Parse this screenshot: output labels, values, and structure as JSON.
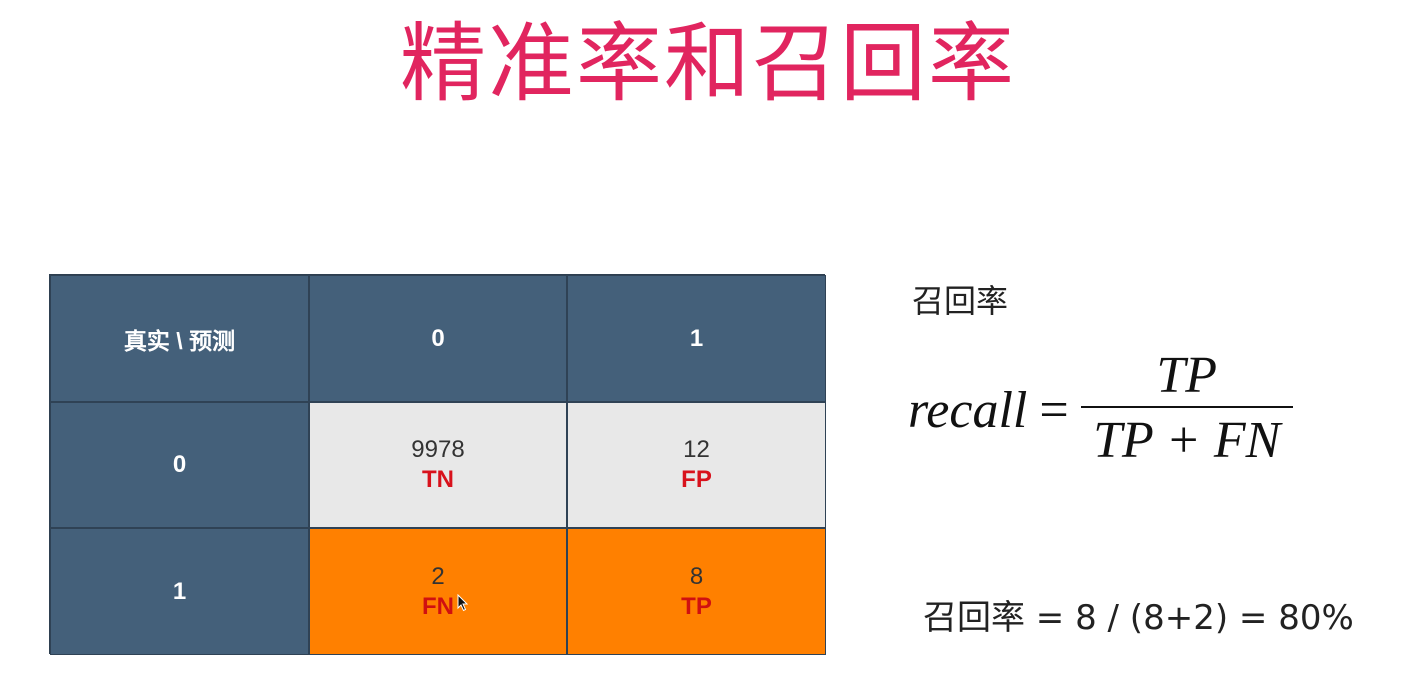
{
  "title": "精准率和召回率",
  "matrix": {
    "corner": "真实 \\ 预测",
    "col_headers": [
      "0",
      "1"
    ],
    "row_headers": [
      "0",
      "1"
    ],
    "cells": [
      [
        {
          "value": "9978",
          "label": "TN"
        },
        {
          "value": "12",
          "label": "FP"
        }
      ],
      [
        {
          "value": "2",
          "label": "FN"
        },
        {
          "value": "8",
          "label": "TP"
        }
      ]
    ]
  },
  "recall": {
    "label": "召回率",
    "lhs": "recall",
    "equals": "=",
    "numerator": "TP",
    "denominator": "TP + FN",
    "calculation": "召回率 = 8 / (8+2) = 80%"
  },
  "colors": {
    "title": "#e1255f",
    "header": "#44607a",
    "light_cell": "#e8e8e8",
    "highlight_cell": "#ff8000",
    "abbreviation": "#d8121c"
  }
}
